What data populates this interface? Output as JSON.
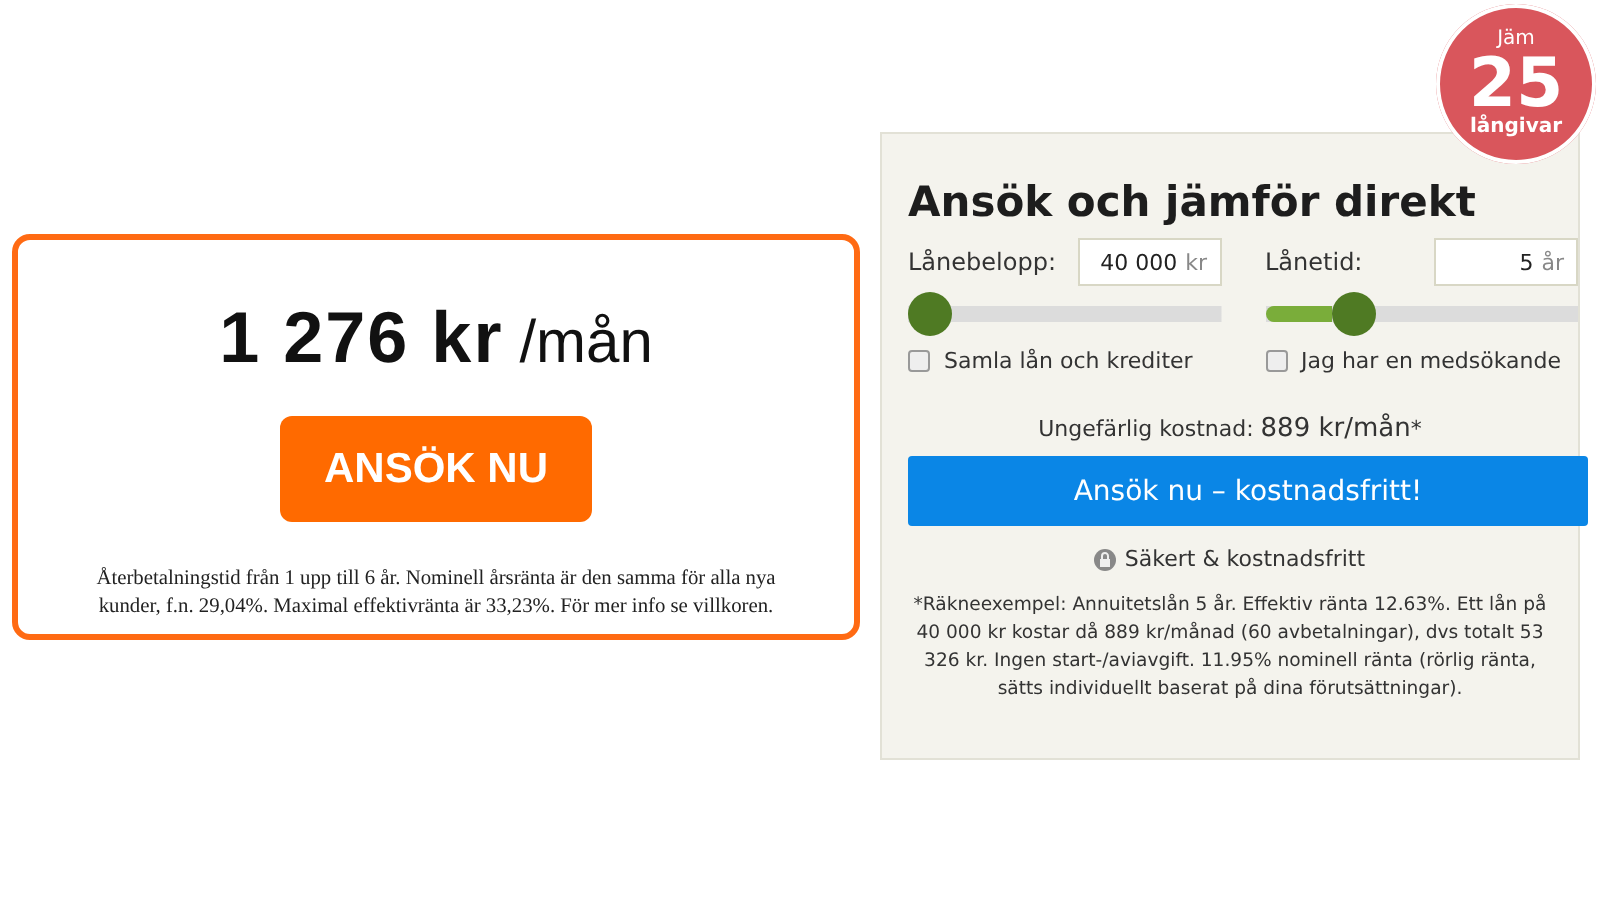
{
  "offer_card": {
    "amount": "1 276 kr",
    "unit": "/mån",
    "button": "ANSÖK NU",
    "terms": "Återbetalningstid från 1 upp till 6 år. Nominell årsränta är den samma för alla nya kunder, f.n. 29,04%. Maximal effektivränta är 33,23%. För mer info se villkoren."
  },
  "loan_form": {
    "title": "Ansök och jämför direkt",
    "fields": [
      {
        "label": "Lånebelopp:",
        "value": "40 000",
        "unit": "kr",
        "level": 0,
        "checkbox": {
          "label": "Samla lån och krediter",
          "checked": false
        }
      },
      {
        "label": "Lånetid:",
        "value": "5",
        "unit": "år",
        "level": 0.25,
        "checkbox": {
          "label": "Jag har en medsökande",
          "checked": false
        }
      }
    ],
    "cost_label": "Ungefärlig kostnad:",
    "cost_value": "889 kr/mån",
    "cost_note": "*",
    "button": "Ansök nu – kostnadsfritt!",
    "secure": "Säkert & kostnadsfritt",
    "example": "*Räkneexempel: Annuitetslån 5 år. Effektiv ränta 12.63%. Ett lån på 40 000 kr kostar då 889 kr/månad (60 avbetalningar), dvs totalt 53 326 kr. Ingen start-/aviavgift. 11.95% nominell ränta (rörlig ränta, sätts individuellt baserat på dina förutsättningar)."
  },
  "badge": {
    "top": "Jäm",
    "number": "25",
    "bottom": "långivar"
  }
}
